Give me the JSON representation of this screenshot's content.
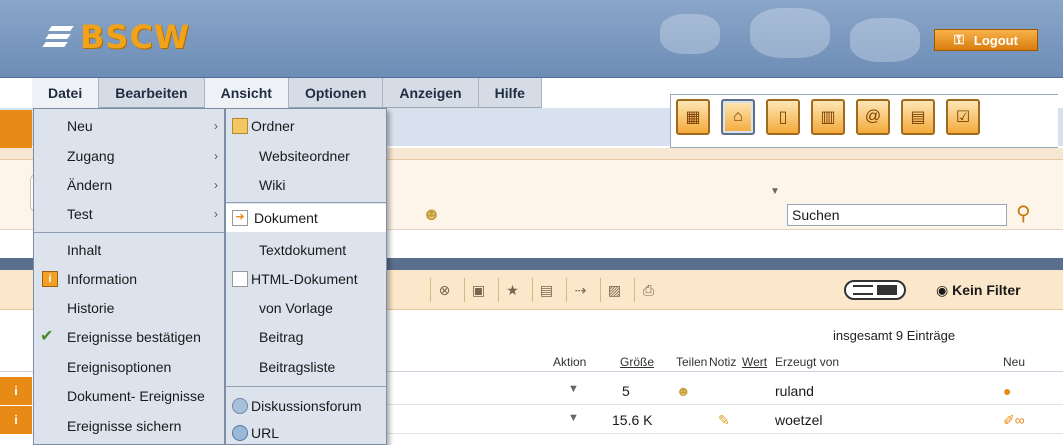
{
  "header": {
    "logo": "BSCW",
    "logout": "Logout"
  },
  "menubar": [
    "Datei",
    "Bearbeiten",
    "Ansicht",
    "Optionen",
    "Anzeigen",
    "Hilfe"
  ],
  "search": {
    "placeholder": "Suchen"
  },
  "view": {
    "filter": "Kein Filter"
  },
  "list": {
    "count": "insgesamt 9 Einträge",
    "columns": {
      "action": "Aktion",
      "size": "Größe",
      "share": "Teilen",
      "note": "Notiz",
      "value": "Wert",
      "creator": "Erzeugt von",
      "new": "Neu"
    },
    "rows": [
      {
        "marker": "i",
        "size": "5",
        "creator": "ruland"
      },
      {
        "marker": "i",
        "size": "15.6 K",
        "creator": "woetzel"
      }
    ]
  },
  "datei_menu": {
    "items": [
      "Neu",
      "Zugang",
      "Ändern",
      "Test",
      "Inhalt",
      "Information",
      "Historie",
      "Ereignisse bestätigen",
      "Ereignisoptionen",
      "Dokument- Ereignisse",
      "Ereignisse sichern"
    ]
  },
  "neu_menu": {
    "items": [
      "Ordner",
      "Websiteordner",
      "Wiki",
      "Dokument",
      "Textdokument",
      "HTML-Dokument",
      "von Vorlage",
      "Beitrag",
      "Beitragsliste",
      "Diskussionsforum",
      "URL"
    ]
  },
  "colors": {
    "accent": "#e88a16",
    "menubg": "#dce3ed",
    "header": "#7794bd"
  }
}
